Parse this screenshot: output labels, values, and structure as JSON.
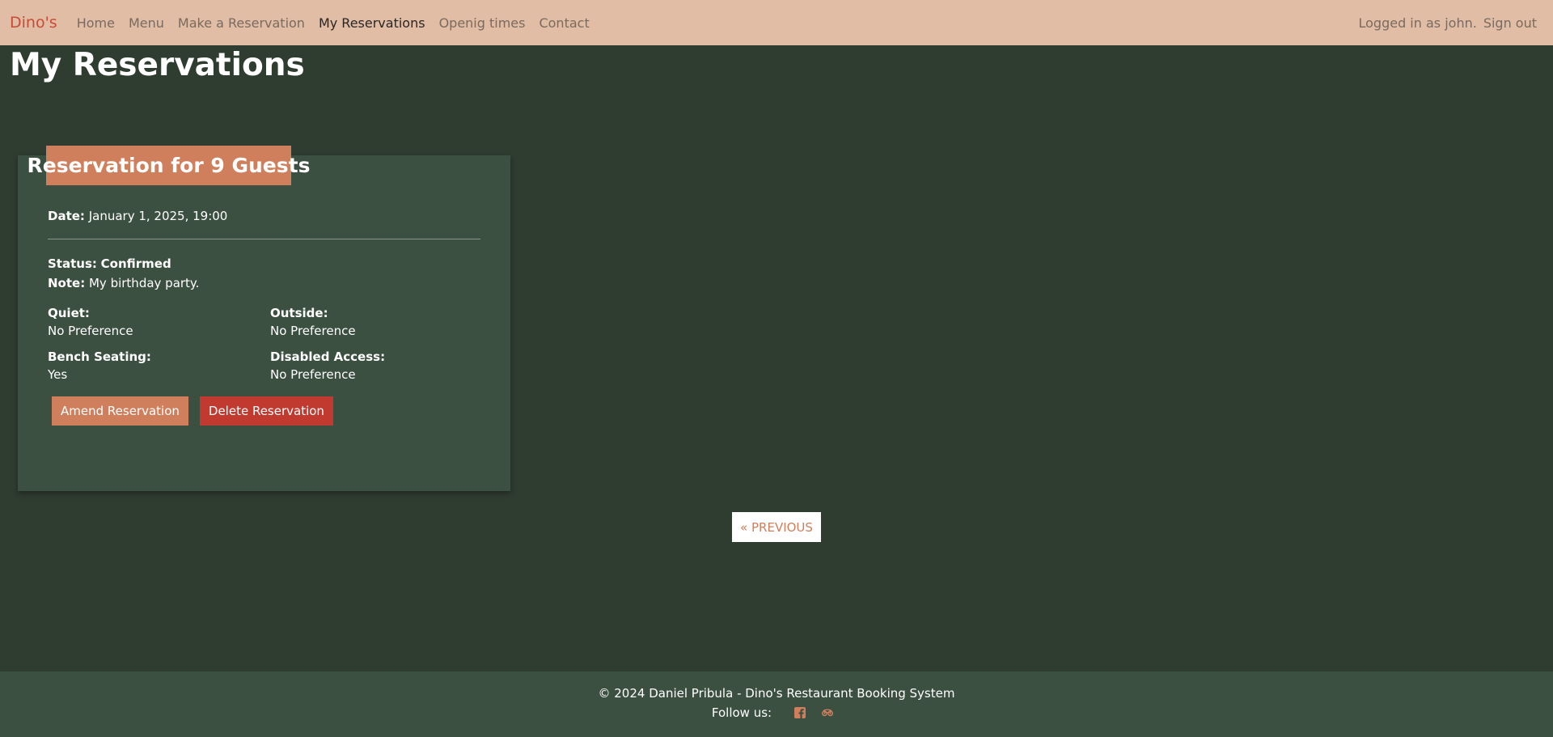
{
  "nav": {
    "brand": "Dino's",
    "links": [
      "Home",
      "Menu",
      "Make a Reservation",
      "My Reservations",
      "Openig times",
      "Contact"
    ],
    "active_index": 3,
    "user_text": "Logged in as john.",
    "signout": "Sign out"
  },
  "page": {
    "title": "My Reservations"
  },
  "reservation": {
    "heading": "Reservation for 9 Guests",
    "date_label": "Date:",
    "date_value": "January 1, 2025, 19:00",
    "status_label": "Status:",
    "status_value": "Confirmed",
    "note_label": "Note:",
    "note_value": "My birthday party.",
    "quiet_label": "Quiet:",
    "quiet_value": "No Preference",
    "outside_label": "Outside:",
    "outside_value": "No Preference",
    "bench_label": "Bench Seating:",
    "bench_value": "Yes",
    "disabled_label": "Disabled Access:",
    "disabled_value": "No Preference",
    "amend_label": "Amend Reservation",
    "delete_label": "Delete Reservation"
  },
  "pagination": {
    "previous": "« PREVIOUS"
  },
  "footer": {
    "copyright": "© 2024 Daniel Pribula - Dino's Restaurant Booking System",
    "follow": "Follow us:",
    "icons": [
      "facebook-icon",
      "tripadvisor-icon"
    ]
  },
  "colors": {
    "background": "#2f3c30",
    "navbar": "#e0bda4",
    "brand": "#c84b38",
    "card": "#3c5042",
    "accent": "#cf7f5c",
    "danger": "#c13a30"
  }
}
